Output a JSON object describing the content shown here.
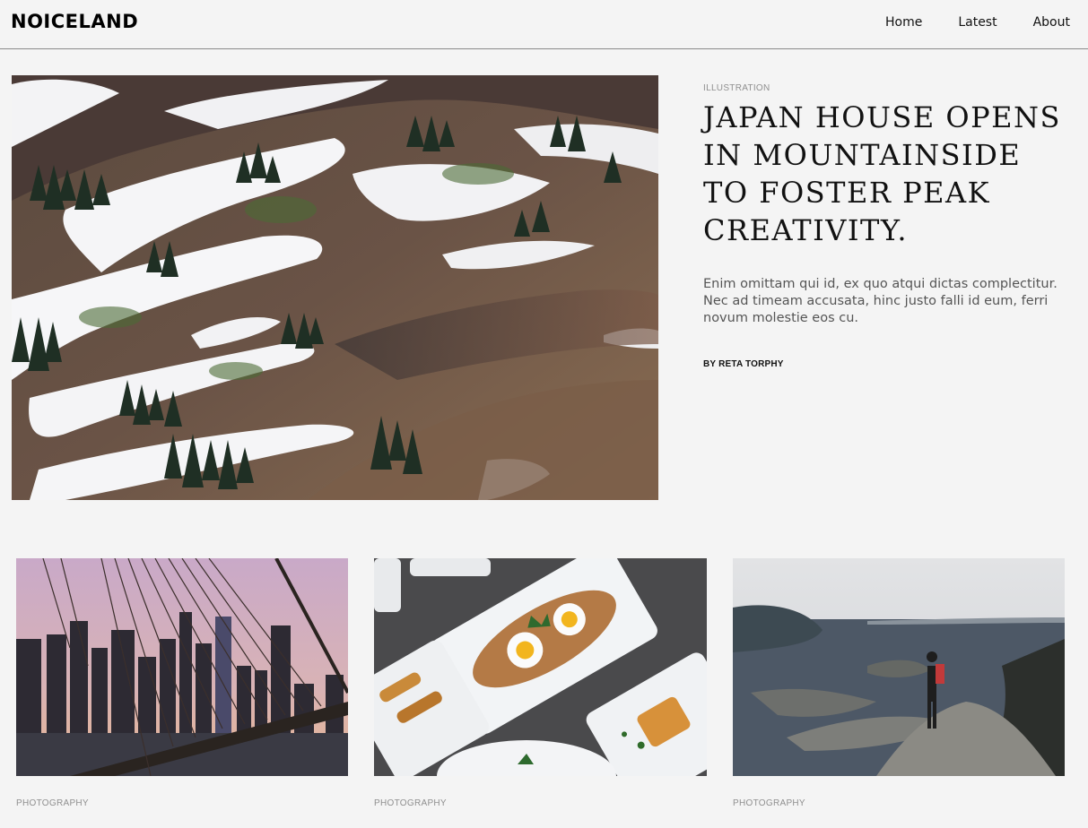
{
  "site": {
    "logo": "NOICELAND"
  },
  "nav": {
    "items": [
      "Home",
      "Latest",
      "About"
    ]
  },
  "hero": {
    "category": "ILLUSTRATION",
    "title": "JAPAN HOUSE OPENS IN MOUNTAINSIDE TO FOSTER PEAK CREATIVITY.",
    "excerpt": "Enim omittam qui id, ex quo atqui dictas complectitur. Nec ad timeam accusata, hinc justo falli id eum, ferri novum molestie eos cu.",
    "byline": "BY RETA TORPHY"
  },
  "cards": [
    {
      "category": "PHOTOGRAPHY"
    },
    {
      "category": "PHOTOGRAPHY"
    },
    {
      "category": "PHOTOGRAPHY"
    }
  ]
}
